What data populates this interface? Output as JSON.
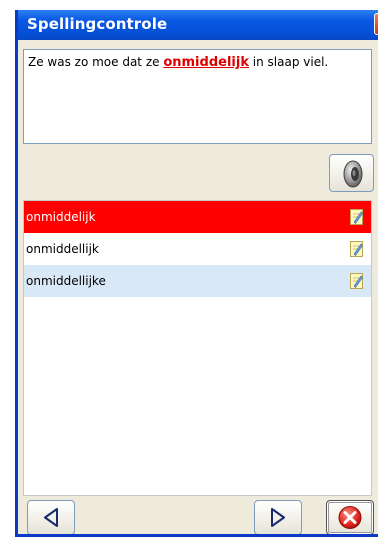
{
  "window": {
    "title": "Spellingcontrole",
    "close_glyph": "X"
  },
  "sentence": {
    "before": "Ze was zo moe dat ze ",
    "error_word": "onmiddelijk",
    "after": " in slaap viel."
  },
  "suggestions": [
    {
      "text": "onmiddelijk",
      "state": "selected"
    },
    {
      "text": "onmiddellijk",
      "state": "normal"
    },
    {
      "text": "onmiddellijke",
      "state": "alternate"
    }
  ],
  "icons": {
    "speaker": "speaker-icon",
    "edit": "edit-pencil-icon",
    "previous": "arrow-left-icon",
    "next": "arrow-right-icon",
    "cancel": "cancel-icon"
  },
  "colors": {
    "title_bar": "#0552d8",
    "error_text": "#e00000",
    "selected_row": "#fe0000",
    "alternate_row": "#d9e8f7",
    "cancel_button": "#e0241e"
  }
}
